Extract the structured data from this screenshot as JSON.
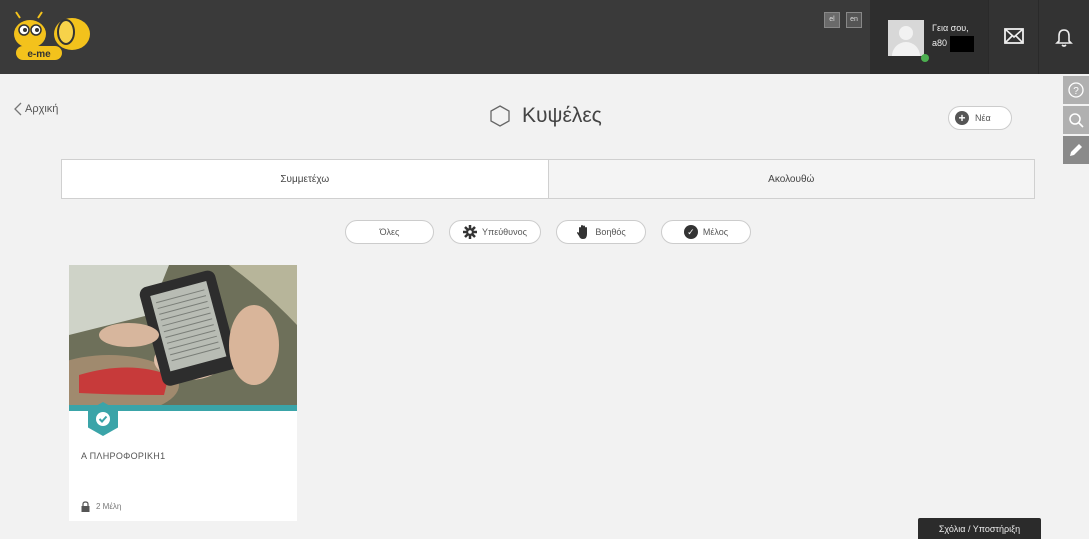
{
  "header": {
    "logo_text": "e-me",
    "lang": {
      "el": "el",
      "en": "en"
    },
    "greeting": "Γεια σου,",
    "username": "a80"
  },
  "nav": {
    "back_label": "Αρχική"
  },
  "page": {
    "title": "Κυψέλες",
    "new_button_label": "Νέα"
  },
  "tabs": [
    {
      "label": "Συμμετέχω",
      "active": true
    },
    {
      "label": "Ακολουθώ",
      "active": false
    }
  ],
  "filters": [
    {
      "label": "Όλες",
      "icon": "none"
    },
    {
      "label": "Υπεύθυνος",
      "icon": "gear-icon"
    },
    {
      "label": "Βοηθός",
      "icon": "hand-icon"
    },
    {
      "label": "Μέλος",
      "icon": "check-icon"
    }
  ],
  "hives": [
    {
      "title": "Α ΠΛΗΡΟΦΟΡΙΚΗ1",
      "members": "2 Μέλη",
      "role_icon": "check-icon",
      "accent": "#3aa4a8"
    }
  ],
  "help_button_label": "Σχόλια / Υποστήριξη",
  "colors": {
    "topbar": "#3a3a3a",
    "accent": "#3aa4a8",
    "online": "#4caf50"
  }
}
